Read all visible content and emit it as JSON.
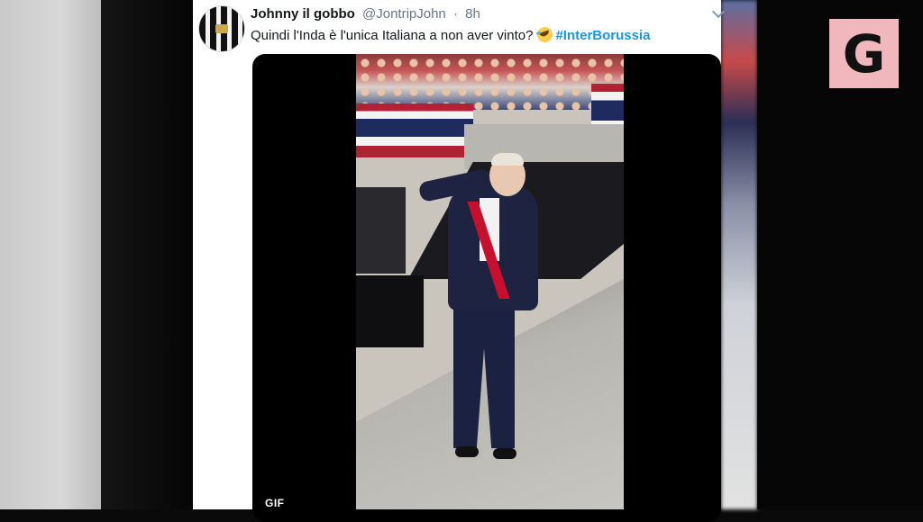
{
  "tweet": {
    "display_name": "Johnny il gobbo",
    "handle": "@JontripJohn",
    "separator": "·",
    "time": "8h",
    "text": "Quindi l'Inda è l'unica Italiana a non aver vinto?",
    "emoji_icon": "rolling-on-the-floor-laughing-emoji",
    "hashtag": "#InterBorussia",
    "hashtag_color": "#1b95e0"
  },
  "media": {
    "badge": "GIF"
  },
  "logo": {
    "letter": "G",
    "background": "#f0b8bd"
  }
}
